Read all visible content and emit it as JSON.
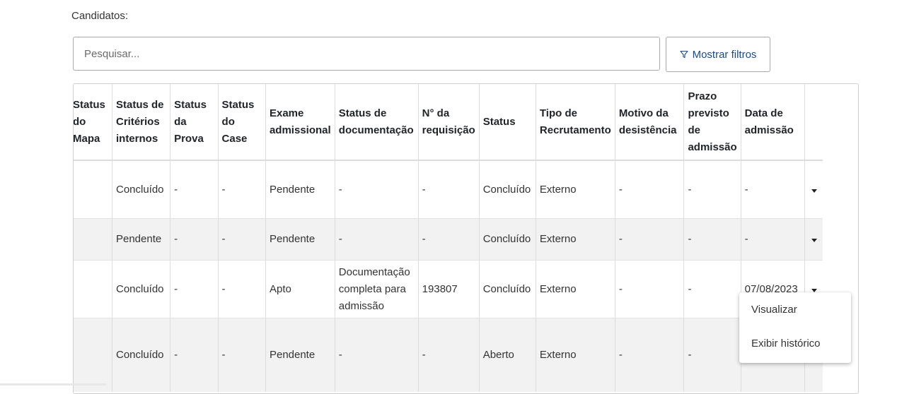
{
  "section_label": "Candidatos:",
  "search": {
    "placeholder": "Pesquisar..."
  },
  "filter_button": {
    "label": "Mostrar filtros",
    "icon": "filter-icon"
  },
  "table": {
    "headers": [
      "Status do Mapa",
      "Status de Critérios internos",
      "Status da Prova",
      "Status do Case",
      "Exame admissional",
      "Status de documentação",
      "N° da requisição",
      "Status",
      "Tipo de Recrutamento",
      "Motivo da desistência",
      "Prazo previsto de admissão",
      "Data de admissão"
    ],
    "rows": [
      [
        "",
        "Concluído",
        "-",
        "-",
        "Pendente",
        "-",
        "-",
        "Concluído",
        "Externo",
        "-",
        "-",
        "-"
      ],
      [
        "",
        "Pendente",
        "-",
        "-",
        "Pendente",
        "-",
        "-",
        "Concluído",
        "Externo",
        "-",
        "-",
        "-"
      ],
      [
        "",
        "Concluído",
        "-",
        "-",
        "Apto",
        "Documentação completa para admissão",
        "193807",
        "Concluído",
        "Externo",
        "-",
        "-",
        "07/08/2023"
      ],
      [
        "",
        "Concluído",
        "-",
        "-",
        "Pendente",
        "-",
        "-",
        "Aberto",
        "Externo",
        "-",
        "-",
        ""
      ]
    ]
  },
  "context_menu": {
    "items": [
      "Visualizar",
      "Exibir histórico"
    ]
  },
  "colors": {
    "accent": "#1c4a86",
    "stripe": "#f2f2f2"
  }
}
